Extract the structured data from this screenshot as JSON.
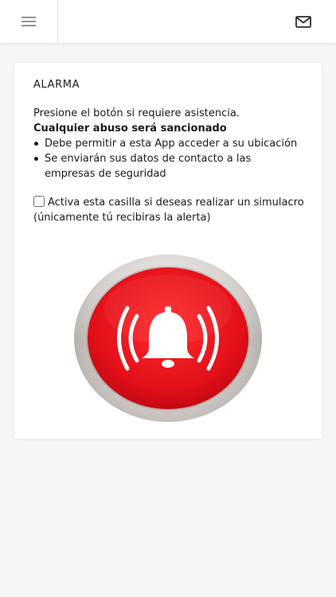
{
  "header": {
    "menu_icon": "hamburger-menu-icon",
    "mail_icon": "envelope-icon"
  },
  "card": {
    "title": "ALARMA",
    "instruction": "Presione el botón si requiere asistencia.",
    "warning": "Cualquier abuso será sancionado",
    "bullets": [
      "Debe permitir a esta App acceder a su ubicación",
      "Se enviarán sus datos de contacto a las empresas de seguridad"
    ],
    "simulation_checkbox": {
      "checked": false,
      "label": "Activa esta casilla si deseas realizar un simulacro (únicamente tú recibiras la alerta)"
    },
    "alarm_button": {
      "icon": "alarm-bell-icon",
      "color": "#e3101a"
    }
  },
  "colors": {
    "background": "#f5f6f8",
    "card": "#ffffff",
    "alarm_red": "#e3101a",
    "alarm_ring": "#c9c4c0"
  }
}
